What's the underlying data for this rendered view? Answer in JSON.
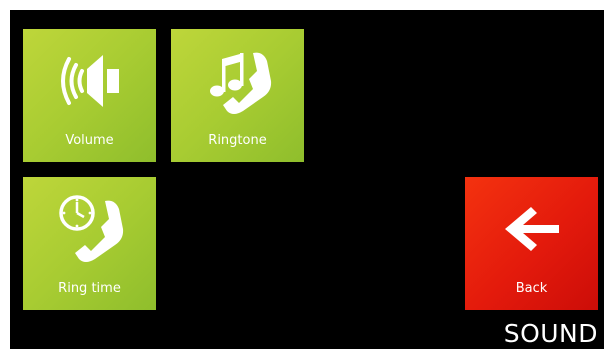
{
  "screen": {
    "title": "SOUND"
  },
  "tiles": [
    {
      "label": "Volume",
      "icon": "speaker-volume-icon"
    },
    {
      "label": "Ringtone",
      "icon": "phone-music-note-icon"
    },
    {
      "label": "Ring time",
      "icon": "phone-clock-icon"
    }
  ],
  "back": {
    "label": "Back",
    "icon": "arrow-left-icon"
  },
  "colors": {
    "tile_green": "#a8cc32",
    "back_red": "#e31a0c",
    "background": "#000000",
    "text": "#ffffff"
  }
}
